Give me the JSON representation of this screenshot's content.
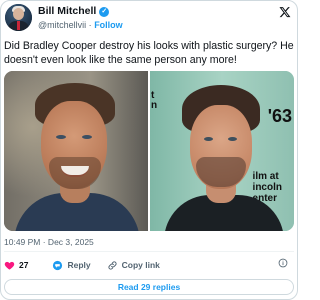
{
  "author": {
    "name": "Bill Mitchell",
    "verified_mark": "✓",
    "handle": "@mitchellvii",
    "separator": "·",
    "follow_label": "Follow"
  },
  "tweet": {
    "text": "Did Bradley Cooper destroy his looks with plastic surgery? He doesn't even look like the same person any more!"
  },
  "media": {
    "right_photo_text_top": "t\nn",
    "right_photo_text_number": "'63",
    "right_photo_text_bottom": "ilm at\nincoln\nenter"
  },
  "meta": {
    "time": "10:49 PM · Dec 3, 2025"
  },
  "actions": {
    "like_count": "27",
    "reply_label": "Reply",
    "copy_label": "Copy link"
  },
  "footer": {
    "read_replies_label": "Read 29 replies"
  },
  "colors": {
    "accent": "#1d9bf0",
    "like": "#f91880",
    "muted": "#536471",
    "border": "#cfd9de"
  }
}
